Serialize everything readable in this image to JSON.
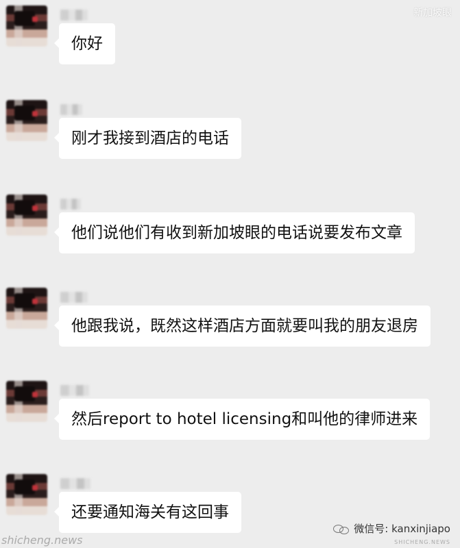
{
  "messages": [
    {
      "text": "你好"
    },
    {
      "text": "刚才我接到酒店的电话"
    },
    {
      "text": "他们说他们有收到新加坡眼的电话说要发布文章"
    },
    {
      "text": "他跟我说，既然这样酒店方面就要叫我的朋友退房"
    },
    {
      "text": "然后report to hotel licensing和叫他的律师进来"
    },
    {
      "text": "还要通知海关有这回事"
    }
  ],
  "watermarks": {
    "top_right": "新加坡眼",
    "bottom_left": "shicheng.news",
    "bottom_right": "微信号: kanxinjiapo",
    "bottom_right_sub": "SHICHENG.NEWS"
  }
}
